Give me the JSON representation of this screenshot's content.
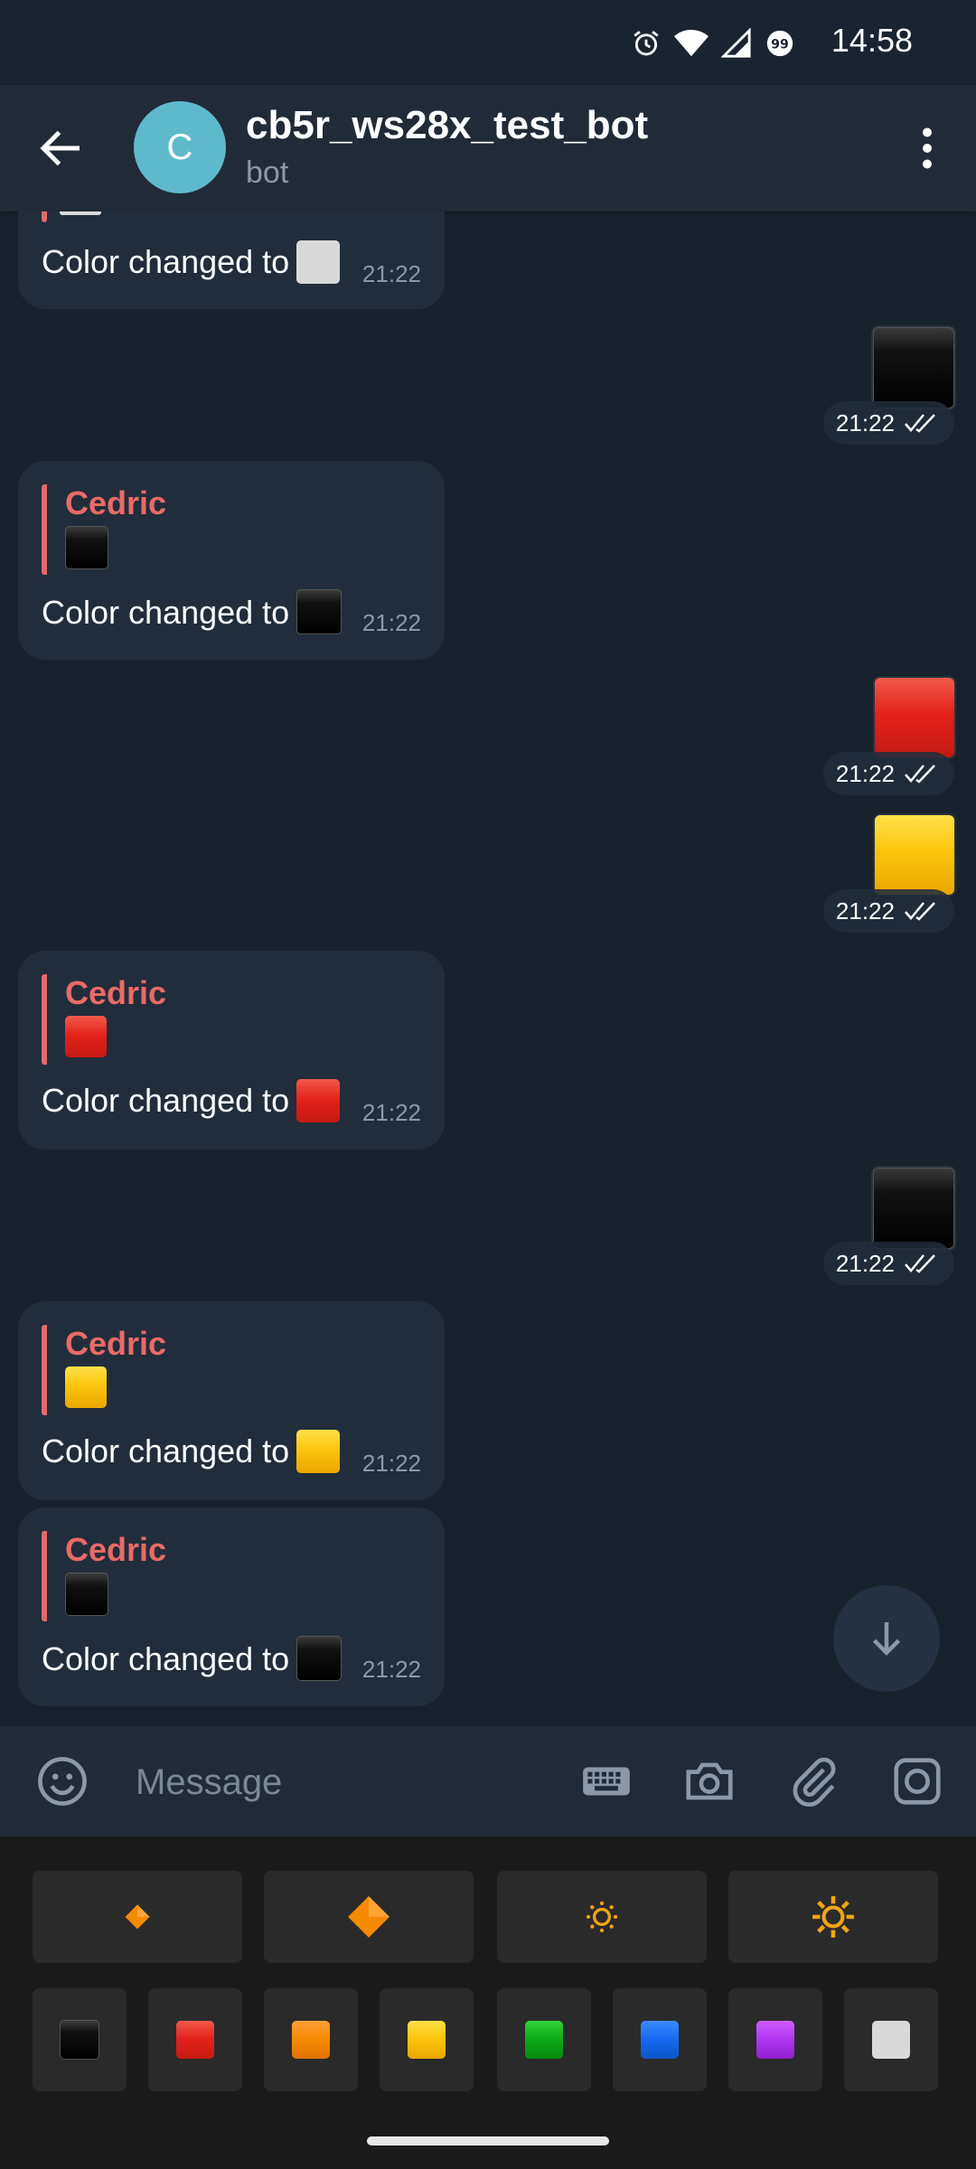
{
  "status_bar": {
    "time": "14:58"
  },
  "header": {
    "back_icon": "arrow-left-icon",
    "avatar_letter": "C",
    "title": "cb5r_ws28x_test_bot",
    "subtitle": "bot",
    "menu_icon": "more-vertical-icon"
  },
  "messages": {
    "m0": {
      "text": "Color changed to",
      "time": "21:22"
    },
    "m1": {
      "time": "21:22"
    },
    "m2": {
      "reply_name": "Cedric",
      "text": "Color changed to",
      "time": "21:22"
    },
    "m3": {
      "time": "21:22"
    },
    "m4": {
      "time": "21:22"
    },
    "m5": {
      "reply_name": "Cedric",
      "text": "Color changed to",
      "time": "21:22"
    },
    "m6": {
      "time": "21:22"
    },
    "m7": {
      "reply_name": "Cedric",
      "text": "Color changed to",
      "time": "21:22"
    },
    "m8": {
      "reply_name": "Cedric",
      "text": "Color changed to",
      "time": "21:22"
    }
  },
  "square_colors": {
    "black": "#000000",
    "red": "#e5231c",
    "yellow": "#fcc60d",
    "white": "#d9d9d9",
    "orange": "#f68a00",
    "green": "#0aa818",
    "blue": "#1668ef",
    "purple": "#ae36ef"
  },
  "input": {
    "placeholder": "Message"
  },
  "keyboard": {
    "row1": [
      "small-orange-diamond-icon",
      "large-orange-diamond-icon",
      "low-brightness-icon",
      "high-brightness-icon"
    ],
    "row2": [
      "black",
      "red",
      "orange",
      "yellow",
      "green",
      "blue",
      "purple",
      "white"
    ]
  },
  "colors": {
    "background": "#18222d",
    "header": "#202b37",
    "incoming_bubble": "#212d3b",
    "reply_name": "#ea6a67",
    "keyboard_bg": "#1b1b1b"
  }
}
